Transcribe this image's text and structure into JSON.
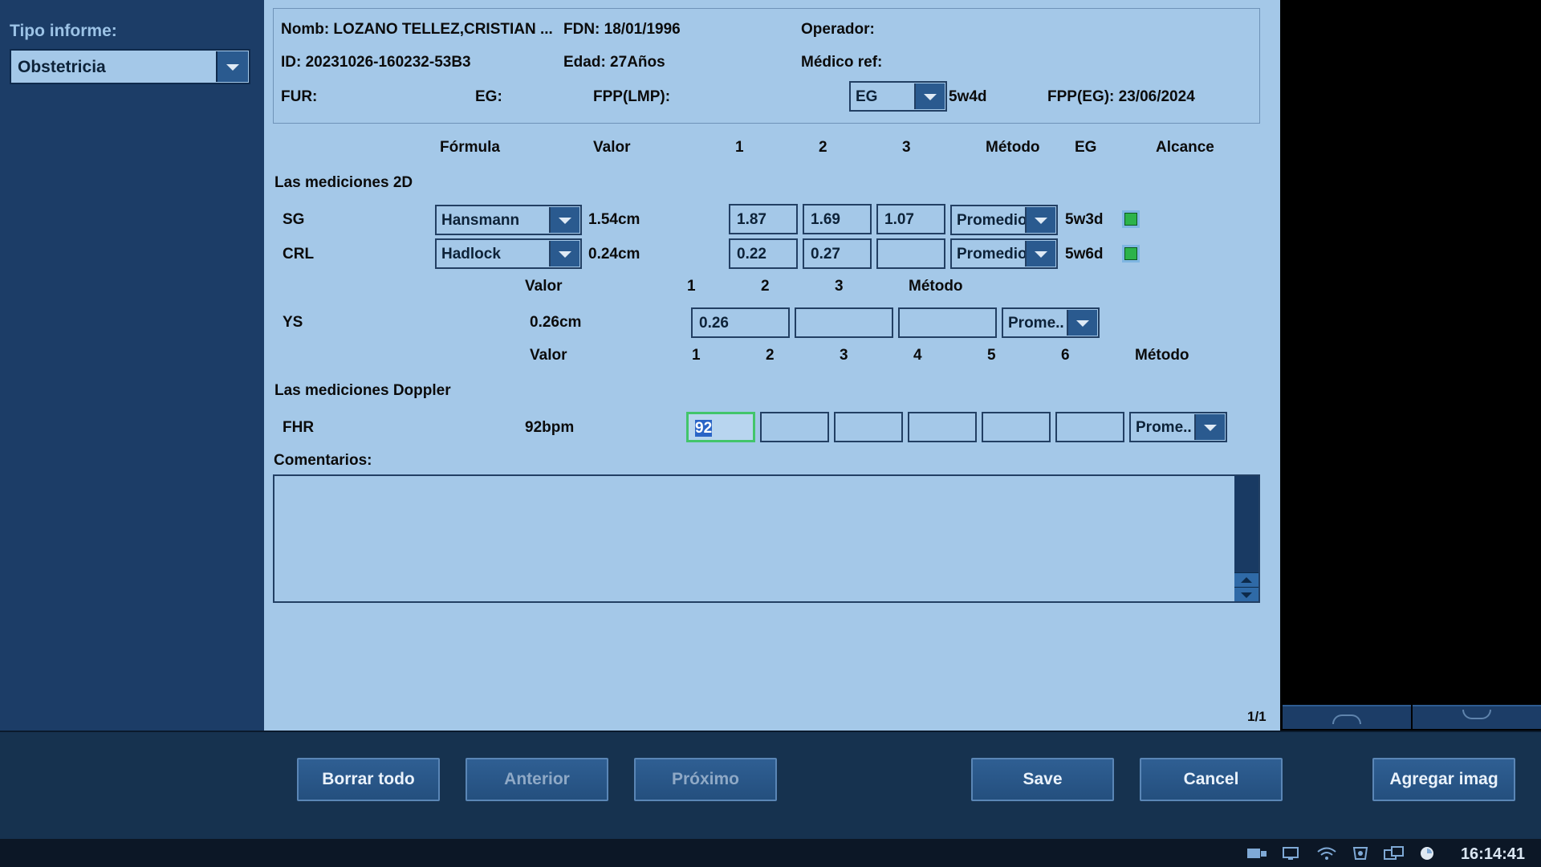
{
  "sidebar": {
    "report_type_label": "Tipo informe:",
    "report_type_value": "Obstetricia"
  },
  "patient": {
    "name": "Nomb: LOZANO TELLEZ,CRISTIAN ...",
    "dob": "FDN: 18/01/1996",
    "operator": "Operador:",
    "id": "ID: 20231026-160232-53B3",
    "age": "Edad: 27Años",
    "ref_doctor": "Médico ref:",
    "lmp": "FUR:",
    "ga": "EG:",
    "edd_lmp": "FPP(LMP):",
    "ga_select": "EG",
    "ga_value": "5w4d",
    "edd_ga": "FPP(EG): 23/06/2024"
  },
  "table2d": {
    "headers": {
      "formula": "Fórmula",
      "value": "Valor",
      "c1": "1",
      "c2": "2",
      "c3": "3",
      "method": "Método",
      "ga": "EG",
      "range": "Alcance"
    },
    "section": "Las mediciones 2D",
    "rows": [
      {
        "name": "SG",
        "formula": "Hansmann",
        "value": "1.54cm",
        "m1": "1.87",
        "m2": "1.69",
        "m3": "1.07",
        "method": "Promedio",
        "ga": "5w3d"
      },
      {
        "name": "CRL",
        "formula": "Hadlock",
        "value": "0.24cm",
        "m1": "0.22",
        "m2": "0.27",
        "m3": "",
        "method": "Promedio",
        "ga": "5w6d"
      }
    ]
  },
  "ys": {
    "headers": {
      "value": "Valor",
      "c1": "1",
      "c2": "2",
      "c3": "3",
      "method": "Método"
    },
    "name": "YS",
    "value": "0.26cm",
    "m1": "0.26",
    "m2": "",
    "m3": "",
    "method": "Prome.."
  },
  "doppler": {
    "headers": {
      "value": "Valor",
      "c1": "1",
      "c2": "2",
      "c3": "3",
      "c4": "4",
      "c5": "5",
      "c6": "6",
      "method": "Método"
    },
    "section": "Las mediciones Doppler",
    "name": "FHR",
    "value": "92bpm",
    "m1": "92",
    "method": "Prome.."
  },
  "comments": {
    "label": "Comentarios:",
    "text": ""
  },
  "page_indicator": "1/1",
  "buttons": {
    "clear_all": "Borrar todo",
    "previous": "Anterior",
    "next": "Próximo",
    "save": "Save",
    "cancel": "Cancel",
    "add_image": "Agregar imag"
  },
  "status": {
    "time": "16:14:41",
    "icons": [
      "storage-icon",
      "network-icon",
      "wifi-icon",
      "print-icon",
      "display-icon",
      "clock-icon"
    ]
  },
  "colors": {
    "panel": "#a4c8e8",
    "sidebar": "#1c3d67",
    "range_ok": "#2cb34a",
    "focus_border": "#42c56b"
  }
}
